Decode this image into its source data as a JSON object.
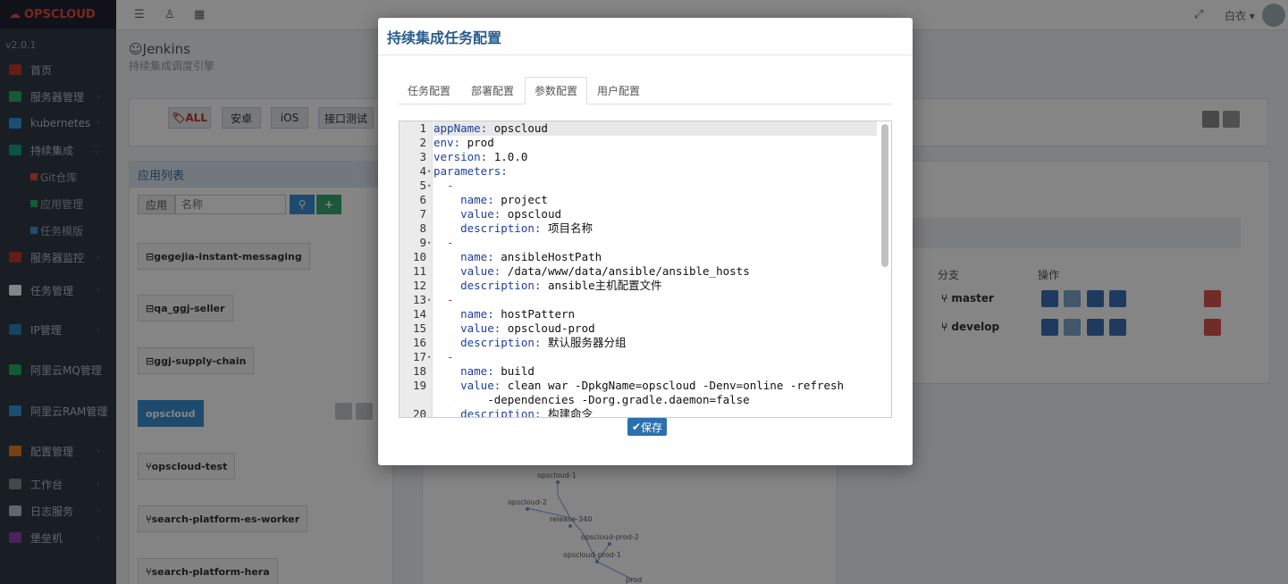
{
  "sidebar": {
    "brand": "OPSCLOUD",
    "version": "v2.0.1",
    "items": [
      {
        "label": "首页",
        "color": "#c0392b"
      },
      {
        "label": "服务器管理",
        "color": "#27ae60"
      },
      {
        "label": "kubernetes",
        "color": "#3498db"
      },
      {
        "label": "持续集成",
        "color": "#16a085"
      },
      {
        "label": "Git仓库",
        "color": "#e74c3c"
      },
      {
        "label": "应用管理",
        "color": "#27ae60"
      },
      {
        "label": "任务模版",
        "color": "#3498db"
      },
      {
        "label": "服务器监控",
        "color": "#c0392b"
      },
      {
        "label": "任务管理",
        "color": "#ffffff"
      },
      {
        "label": "IP管理",
        "color": "#2980b9"
      },
      {
        "label": "阿里云MQ管理",
        "color": "#27ae60"
      },
      {
        "label": "阿里云RAM管理",
        "color": "#3498db"
      },
      {
        "label": "配置管理",
        "color": "#e67e22"
      },
      {
        "label": "工作台",
        "color": "#7f8c8d"
      },
      {
        "label": "日志服务",
        "color": "#bdc3c7"
      },
      {
        "label": "堡垒机",
        "color": "#8e44ad"
      }
    ]
  },
  "topbar": {
    "user": "白衣"
  },
  "page": {
    "title": "Jenkins",
    "subtitle": "持续集成调度引擎"
  },
  "filters": [
    "ALL",
    "安卓",
    "iOS",
    "接口测试"
  ],
  "app_list": {
    "title": "应用列表",
    "search_prefix": "应用",
    "search_placeholder": "名称",
    "items": [
      "gegejia-instant-messaging",
      "qa_ggj-seller",
      "ggj-supply-chain",
      "opscloud",
      "opscloud-test",
      "search-platform-es-worker",
      "search-platform-hera"
    ]
  },
  "table": {
    "headers": [
      "分支",
      "操作"
    ],
    "rows": [
      {
        "branch": "master"
      },
      {
        "branch": "develop"
      }
    ]
  },
  "graph": {
    "nodes": [
      "opscloud-1",
      "opscloud-2",
      "release-340",
      "opscloud-prod-2",
      "opscloud-prod-1",
      "prod"
    ]
  },
  "modal": {
    "title": "持续集成任务配置",
    "tabs": [
      "任务配置",
      "部署配置",
      "参数配置",
      "用户配置"
    ],
    "active_tab": "参数配置",
    "save_label": "保存",
    "code_lines": [
      {
        "n": "1",
        "key": "appName:",
        "val": " opscloud"
      },
      {
        "n": "2",
        "key": "env:",
        "val": " prod"
      },
      {
        "n": "3",
        "key": "version:",
        "val": " 1.0.0"
      },
      {
        "n": "4",
        "key": "parameters:",
        "val": ""
      },
      {
        "n": "5",
        "key": "",
        "val": "  -"
      },
      {
        "n": "6",
        "key": "    name:",
        "val": " project"
      },
      {
        "n": "7",
        "key": "    value:",
        "val": " opscloud"
      },
      {
        "n": "8",
        "key": "    description:",
        "val": " 项目名称"
      },
      {
        "n": "9",
        "key": "",
        "val": "  -"
      },
      {
        "n": "10",
        "key": "    name:",
        "val": " ansibleHostPath"
      },
      {
        "n": "11",
        "key": "    value:",
        "val": " /data/www/data/ansible/ansible_hosts"
      },
      {
        "n": "12",
        "key": "    description:",
        "val": " ansible主机配置文件"
      },
      {
        "n": "13",
        "key": "",
        "val": "  -"
      },
      {
        "n": "14",
        "key": "    name:",
        "val": " hostPattern"
      },
      {
        "n": "15",
        "key": "    value:",
        "val": " opscloud-prod"
      },
      {
        "n": "16",
        "key": "    description:",
        "val": " 默认服务器分组"
      },
      {
        "n": "17",
        "key": "",
        "val": "  -"
      },
      {
        "n": "18",
        "key": "    name:",
        "val": " build"
      },
      {
        "n": "19",
        "key": "    value:",
        "val": " clean war -DpkgName=opscloud -Denv=online -refresh"
      },
      {
        "n": "",
        "key": "",
        "val": "        -dependencies -Dorg.gradle.daemon=false"
      },
      {
        "n": "20",
        "key": "    description:",
        "val": " 构建命令"
      }
    ]
  }
}
